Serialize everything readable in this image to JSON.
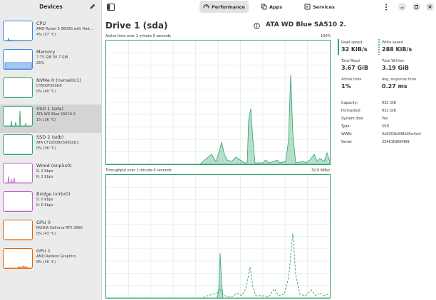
{
  "sidebar": {
    "title": "Devices",
    "devices": [
      {
        "name": "CPU",
        "line2": "AMD Ryzen 5 5600G with Rad…",
        "line3": "4% (57 °C)",
        "color": "#3584e4",
        "selected": false
      },
      {
        "name": "Memory",
        "line2": "7.75 GiB 30.7 GiB",
        "line3": "25%",
        "color": "#3584e4",
        "selected": false
      },
      {
        "name": "NVMe 0 (nvme0n1)",
        "line2": "CT500P3SSD8",
        "line3": "0% (40 °C)",
        "color": "#2ea36b",
        "selected": false
      },
      {
        "name": "SSD 1 (sda)",
        "line2": "ATA WD Blue SA510 2.",
        "line3": "1% (36 °C)",
        "color": "#2ea36b",
        "selected": true
      },
      {
        "name": "SSD 2 (sdb)",
        "line2": "ATA CT1000BX500SSD1",
        "line3": "0% (36 °C)",
        "color": "#2ea36b",
        "selected": false
      },
      {
        "name": "Wired (enp5s0)",
        "line2": "S: 2 Kbps",
        "line3": "R: 2 Kbps",
        "color": "#c061cb",
        "selected": false
      },
      {
        "name": "Bridge (virbr0)",
        "line2": "S: 0 Kbps",
        "line3": "R: 0 Kbps",
        "color": "#c061cb",
        "selected": false
      },
      {
        "name": "GPU 0",
        "line2": "NVIDIA GeForce RTX 3060",
        "line3": "0% (43 °C)",
        "color": "#e66100",
        "selected": false
      },
      {
        "name": "GPU 1",
        "line2": "AMD Radeon Graphics",
        "line3": "9% (46 °C)",
        "color": "#e66100",
        "selected": false
      }
    ]
  },
  "toolbar": {
    "tabs": [
      {
        "label": "Performance",
        "active": true
      },
      {
        "label": "Apps",
        "active": false
      },
      {
        "label": "Services",
        "active": false
      }
    ]
  },
  "drive": {
    "title": "Drive 1 (sda)",
    "model": "ATA WD Blue SA510 2."
  },
  "graphs": {
    "active": {
      "label": "Active time over 1 minute 0 seconds",
      "max": "100%"
    },
    "throughput": {
      "label": "Throughput over 1 minute 0 seconds",
      "max": "32.0 MiB/s"
    }
  },
  "stats": {
    "read_speed": {
      "label": "Read speed",
      "value": "32 KiB/s"
    },
    "write_speed": {
      "label": "Write speed",
      "value": "288 KiB/s"
    },
    "total_read": {
      "label": "Total Read",
      "value": "3.67 GiB"
    },
    "total_written": {
      "label": "Total Written",
      "value": "3.19 GiB"
    },
    "active_time": {
      "label": "Active time",
      "value": "1%"
    },
    "avg_response": {
      "label": "Avg. response time",
      "value": "0.27 ms"
    }
  },
  "properties": [
    {
      "label": "Capacity:",
      "value": "932 GiB"
    },
    {
      "label": "Formatted:",
      "value": "932 GiB"
    },
    {
      "label": "System disk:",
      "value": "Yes"
    },
    {
      "label": "Type:",
      "value": "SSD"
    },
    {
      "label": "WWN:",
      "value": "0x5001b448b35e4ccf"
    },
    {
      "label": "Serial:",
      "value": "23461N800499"
    }
  ],
  "series": {
    "active_time_pct": [
      0,
      0,
      0,
      0,
      0,
      0,
      0,
      0,
      0,
      0,
      0,
      0,
      0,
      0,
      0,
      0,
      0,
      0,
      0,
      0,
      0,
      0,
      0,
      0,
      0,
      0,
      0,
      0,
      0,
      0,
      0,
      0,
      0,
      0,
      0,
      0,
      0,
      0,
      0,
      0,
      0,
      0,
      0,
      0,
      0,
      0,
      0,
      0,
      0,
      0,
      0,
      0,
      0,
      0,
      0,
      0,
      0,
      0,
      0,
      0,
      0,
      0,
      0,
      0,
      0,
      0,
      0,
      0,
      0,
      0,
      0,
      0,
      0,
      0,
      0,
      0,
      0,
      0,
      0,
      0,
      0,
      0,
      0,
      0,
      0,
      0,
      0,
      0,
      0,
      0,
      0,
      0,
      0,
      0,
      0,
      0,
      0,
      0,
      0,
      0,
      0,
      0,
      0,
      0,
      0,
      0,
      0,
      0,
      0,
      0,
      0,
      2,
      4,
      6,
      5,
      3,
      4,
      7,
      10,
      14,
      9,
      4,
      2,
      3,
      5,
      4,
      3,
      2,
      2,
      3,
      5,
      45,
      58,
      30,
      4,
      2,
      1,
      2,
      3,
      4,
      2,
      3,
      2,
      2,
      3,
      2,
      3,
      4,
      78,
      4,
      2,
      3,
      2,
      2,
      3,
      5,
      2,
      3,
      3,
      4,
      2,
      4,
      6,
      8,
      4,
      3
    ],
    "read_mibs": [
      0,
      0,
      0,
      0,
      0,
      0,
      0,
      0,
      0,
      0,
      0,
      0,
      0,
      0,
      0,
      0,
      0,
      0,
      0,
      0,
      0,
      0,
      0,
      0,
      0,
      0,
      0,
      0,
      0,
      0,
      0,
      0,
      0,
      0,
      0,
      0,
      0,
      0,
      0,
      0,
      0,
      0,
      0,
      0,
      0,
      0,
      0,
      0,
      0,
      0,
      0,
      0,
      0,
      0,
      0,
      0,
      0,
      0,
      0,
      0,
      0,
      0,
      0,
      0,
      0,
      0,
      0,
      0,
      0,
      0,
      0,
      0,
      0,
      0,
      0,
      0,
      0,
      0,
      0,
      0,
      0,
      0,
      0,
      0,
      0,
      0,
      0,
      0,
      0,
      0,
      0,
      0,
      0,
      0,
      0,
      0,
      0,
      0,
      0,
      0,
      0,
      0,
      0,
      0,
      0,
      0,
      0,
      0,
      0,
      0,
      0,
      0,
      0,
      0,
      0,
      0,
      0,
      0,
      0,
      0,
      0,
      0,
      0,
      0,
      0,
      0,
      0,
      0,
      0,
      0,
      0,
      0,
      0,
      0,
      0,
      0,
      0,
      0,
      0,
      0,
      0,
      0,
      0,
      0,
      0,
      0,
      0,
      0,
      0,
      0,
      0,
      0,
      0,
      0,
      0,
      0,
      0,
      0,
      0,
      0,
      0,
      0,
      0,
      0,
      0,
      0,
      0,
      0,
      0,
      0,
      0,
      0,
      0,
      0,
      0,
      0,
      0,
      0,
      0,
      0,
      0,
      0,
      0,
      0
    ],
    "write_mibs": [
      0,
      0,
      0,
      0,
      0,
      0,
      0,
      0,
      0,
      0,
      0,
      0,
      0,
      0,
      0,
      0,
      0,
      0,
      0,
      0,
      0,
      0,
      0,
      0,
      0,
      0,
      0,
      0,
      0,
      0,
      0,
      0,
      0,
      0,
      0,
      0,
      0,
      0,
      0,
      0,
      0,
      0,
      0,
      0,
      0,
      0,
      0,
      0,
      0,
      0,
      0,
      0,
      0,
      0,
      0,
      0,
      0,
      0,
      0,
      0,
      0,
      0,
      0,
      0,
      0,
      0,
      0,
      0,
      0,
      0,
      0,
      0,
      0,
      0,
      0,
      0,
      0,
      0,
      0,
      0,
      0,
      0,
      0,
      0,
      0,
      0,
      0,
      0,
      0,
      0,
      0,
      0,
      0,
      0,
      0,
      0,
      0,
      0,
      0,
      0,
      0,
      0,
      0,
      0,
      0,
      0,
      0,
      0,
      0,
      0,
      0,
      0,
      0,
      0,
      0,
      0,
      0,
      0,
      0,
      0,
      0,
      0,
      0,
      0,
      0,
      0,
      0,
      0,
      0,
      0,
      0,
      0,
      0,
      0,
      0,
      0,
      0,
      0,
      0,
      0,
      0,
      0,
      0,
      0,
      0,
      0,
      0,
      0,
      0,
      0,
      0,
      0,
      0,
      0,
      0,
      0,
      0,
      0,
      0,
      0,
      0,
      0,
      0,
      0,
      0,
      0,
      0,
      0,
      0,
      0,
      0,
      0,
      0,
      0,
      0,
      0,
      0,
      0,
      0,
      0,
      0,
      0,
      0,
      0
    ]
  }
}
